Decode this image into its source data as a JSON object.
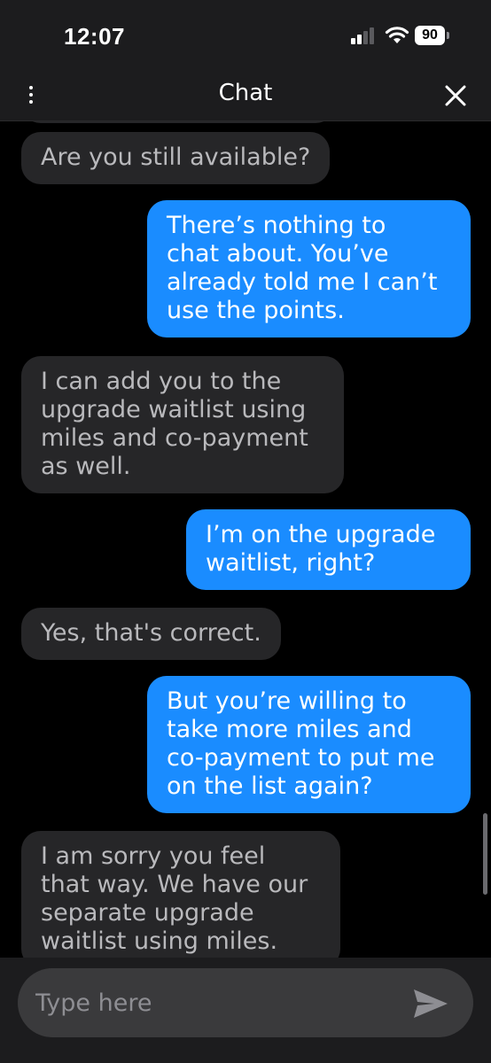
{
  "status_bar": {
    "time": "12:07",
    "battery": "90",
    "icons": [
      "signal-icon",
      "wifi-icon",
      "battery-icon"
    ]
  },
  "header": {
    "title": "Chat",
    "menu_icon": "more-vertical-icon",
    "close_icon": "close-icon"
  },
  "messages": [
    {
      "sender": "agent",
      "lines": [
        "Are you still available?"
      ]
    },
    {
      "sender": "user",
      "lines": [
        "There’s nothing to",
        "chat about. You’ve",
        "already told me I can’t",
        "use the points."
      ]
    },
    {
      "sender": "agent",
      "lines": [
        "I can add you to the",
        "upgrade waitlist using",
        "miles and co-payment",
        "as well."
      ]
    },
    {
      "sender": "user",
      "lines": [
        "I’m on the upgrade",
        "waitlist, right?"
      ]
    },
    {
      "sender": "agent",
      "lines": [
        "Yes, that's correct."
      ]
    },
    {
      "sender": "user",
      "lines": [
        "But you’re willing to",
        "take more miles and",
        "co-payment to put me",
        "on the list again?"
      ]
    },
    {
      "sender": "agent",
      "lines": [
        "I am sorry you feel",
        "that way. We have our",
        "separate upgrade",
        "waitlist using miles."
      ]
    }
  ],
  "composer": {
    "placeholder": "Type here",
    "value": "",
    "send_icon": "send-icon"
  },
  "colors": {
    "user_bubble": "#1a8cff",
    "agent_bubble": "#262628",
    "background": "#000000"
  }
}
